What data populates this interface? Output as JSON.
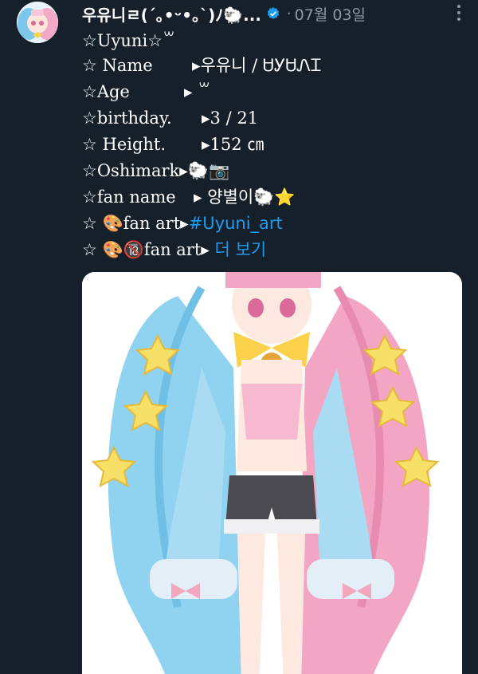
{
  "tweet": {
    "author_name": "우유니ㄹ(´｡•ᵕ•｡`)ﾉ🐑...",
    "date_sep": "·",
    "date": "07월 03일"
  },
  "bio": [
    {
      "key": "☆Uyuni☆",
      "value": " ꒳ "
    },
    {
      "key": "☆ Name",
      "value": "▸우유니 / ᏌᎩᏌᏁᏆ"
    },
    {
      "key": "☆Age",
      "value": "▸ ꒳ "
    },
    {
      "key": "☆birthday.",
      "value": "▸3 / 21"
    },
    {
      "key": "☆ Height.",
      "value": "▸152 ㎝"
    },
    {
      "key": "☆Oshimark",
      "value": "▸🐑📷"
    },
    {
      "key": "☆fan name",
      "value": "▸  양별이🐑⭐"
    },
    {
      "key": "☆ 🎨fan art",
      "value": "▸",
      "link": "#Uyuni_art"
    },
    {
      "key": "☆ 🎨🔞fan art",
      "value": "▸",
      "link": "더 보기"
    }
  ],
  "icons": {
    "verified": "verified-badge-icon",
    "more": "more-options-icon"
  },
  "colors": {
    "background": "#15202b",
    "link": "#1d9bf0",
    "muted": "#8b98a5"
  }
}
